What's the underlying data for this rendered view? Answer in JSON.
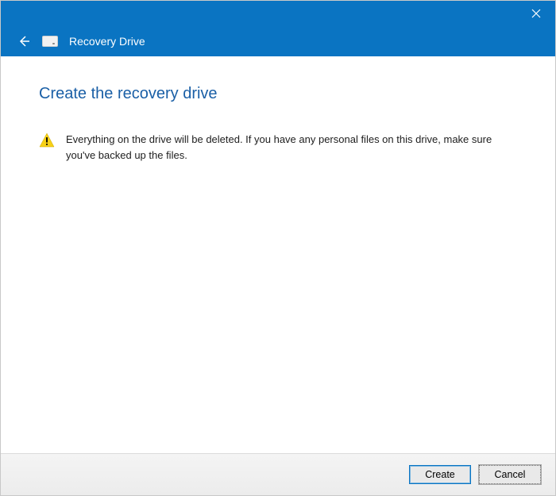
{
  "titlebar": {
    "window_title": "Recovery Drive"
  },
  "content": {
    "heading": "Create the recovery drive",
    "warning_text": "Everything on the drive will be deleted. If you have any personal files on this drive, make sure you've backed up the files."
  },
  "footer": {
    "create_label": "Create",
    "cancel_label": "Cancel"
  },
  "colors": {
    "accent": "#0a74c2",
    "heading": "#1a5fa6",
    "warn_triangle": "#f7d117"
  }
}
